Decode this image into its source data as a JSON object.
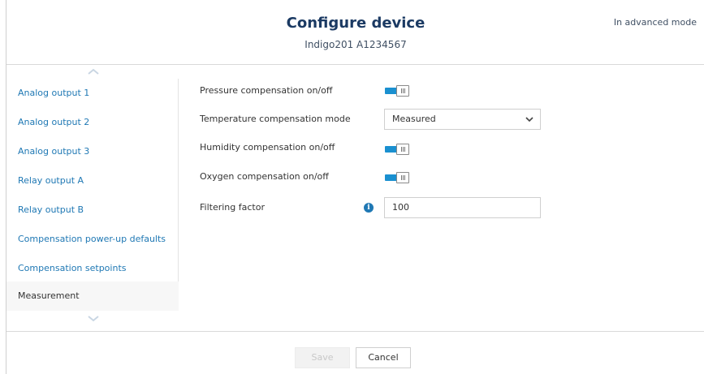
{
  "header": {
    "title": "Configure device",
    "subtitle": "Indigo201 A1234567",
    "mode_label": "In advanced mode"
  },
  "sidebar": {
    "items": [
      {
        "label": "Analog output 1",
        "active": false
      },
      {
        "label": "Analog output 2",
        "active": false
      },
      {
        "label": "Analog output 3",
        "active": false
      },
      {
        "label": "Relay output A",
        "active": false
      },
      {
        "label": "Relay output B",
        "active": false
      },
      {
        "label": "Compensation power-up defaults",
        "active": false
      },
      {
        "label": "Compensation setpoints",
        "active": false
      },
      {
        "label": "Measurement",
        "active": true
      }
    ]
  },
  "form": {
    "pressure_label": "Pressure compensation on/off",
    "pressure_on": true,
    "temperature_label": "Temperature compensation mode",
    "temperature_value": "Measured",
    "humidity_label": "Humidity compensation on/off",
    "humidity_on": true,
    "oxygen_label": "Oxygen compensation on/off",
    "oxygen_on": true,
    "filtering_label": "Filtering factor",
    "filtering_value": "100"
  },
  "footer": {
    "save_label": "Save",
    "cancel_label": "Cancel"
  },
  "colors": {
    "accent": "#1a90d0",
    "link": "#1f78b4",
    "title": "#1b3a63"
  }
}
